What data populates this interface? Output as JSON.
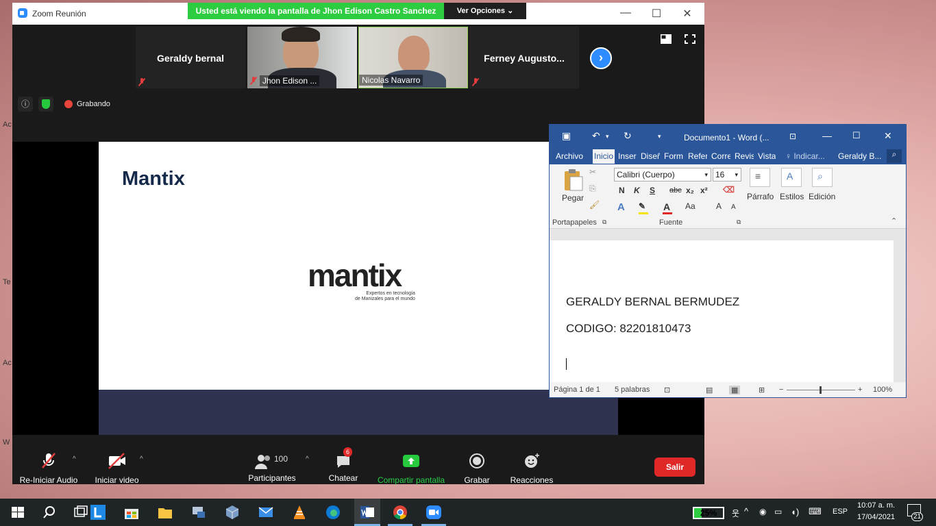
{
  "desktop": {
    "side_labels": [
      "Ac",
      "Te",
      "Ac",
      "W"
    ]
  },
  "zoom": {
    "title": "Zoom Reunión",
    "share_banner": "Usted está viendo la pantalla de Jhon Edison Castro Sanchez",
    "view_options": "Ver Opciones",
    "participants": [
      {
        "name": "Geraldy bernal",
        "caption": "",
        "video": false
      },
      {
        "name": "",
        "caption": "Jhon Edison ...",
        "video": true
      },
      {
        "name": "",
        "caption": "Nicolas Navarro",
        "video": true
      },
      {
        "name": "Ferney  Augusto...",
        "caption": "",
        "video": false
      }
    ],
    "recording_label": "Grabando",
    "slide": {
      "title": "Mantix",
      "logo_text": "mantix",
      "tagline_1": "Expertos en tecnología",
      "tagline_2": "de Manizales para el mundo"
    },
    "toolbar": {
      "audio": "Re-Iniciar Audio",
      "video": "Iniciar video",
      "participants": "Participantes",
      "participants_count": "100",
      "chat": "Chatear",
      "chat_badge": "6",
      "share": "Compartir pantalla",
      "record": "Grabar",
      "reactions": "Reacciones",
      "leave": "Salir"
    }
  },
  "word": {
    "title": "Documento1 - Word (...",
    "tabs": [
      "Archivo",
      "Inicio",
      "Inser",
      "Diseñ",
      "Form",
      "Refer",
      "Corre",
      "Revis",
      "Vista"
    ],
    "tell_me": "Indicar...",
    "user": "Geraldy B...",
    "ribbon": {
      "paste": "Pegar",
      "clipboard_group": "Portapapeles",
      "font_name": "Calibri (Cuerpo)",
      "font_size": "16",
      "font_group": "Fuente",
      "paragraph": "Párrafo",
      "styles": "Estilos",
      "editing": "Edición",
      "bold": "N",
      "italic": "K",
      "underline": "S",
      "strike": "abc",
      "sub": "x₂",
      "sup": "x²"
    },
    "document_lines": [
      "GERALDY BERNAL BERMUDEZ",
      "CODIGO: 82201810473"
    ],
    "status": {
      "page": "Página 1 de 1",
      "words": "5 palabras",
      "zoom": "100%"
    }
  },
  "taskbar": {
    "battery": "25%",
    "battery_level": 0.25,
    "language": "ESP",
    "time": "10:07 a. m.",
    "date": "17/04/2021",
    "notifications": "21"
  }
}
